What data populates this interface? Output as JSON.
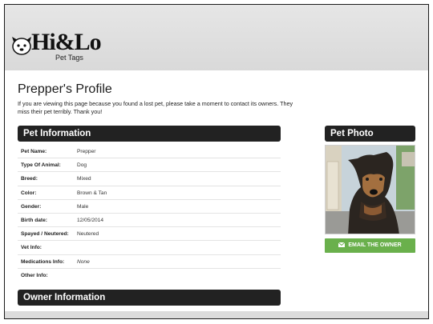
{
  "brand": {
    "logo_text": "Hi&Lo",
    "logo_subtext": "Pet Tags"
  },
  "page": {
    "title": "Prepper's Profile",
    "intro": "If you are viewing this page because you found a lost pet, please take a moment to contact its owners. They miss their pet terribly. Thank you!"
  },
  "pet_information": {
    "heading": "Pet Information",
    "rows": [
      {
        "label": "Pet Name:",
        "value": "Prepper"
      },
      {
        "label": "Type Of Animal:",
        "value": "Dog"
      },
      {
        "label": "Breed:",
        "value": "Mixed"
      },
      {
        "label": "Color:",
        "value": "Brown & Tan"
      },
      {
        "label": "Gender:",
        "value": "Male"
      },
      {
        "label": "Birth date:",
        "value": "12/05/2014"
      },
      {
        "label": "Spayed / Neutered:",
        "value": "Neutered"
      },
      {
        "label": "Vet Info:",
        "value": ""
      },
      {
        "label": "Medications Info:",
        "value": "None"
      },
      {
        "label": "Other Info:",
        "value": ""
      }
    ]
  },
  "owner_information": {
    "heading": "Owner Information"
  },
  "pet_photo": {
    "heading": "Pet Photo",
    "email_button_label": "EMAIL THE OWNER"
  },
  "colors": {
    "header_bg": "#e0e0e0",
    "section_bar": "#222222",
    "email_button": "#6ab04c"
  }
}
